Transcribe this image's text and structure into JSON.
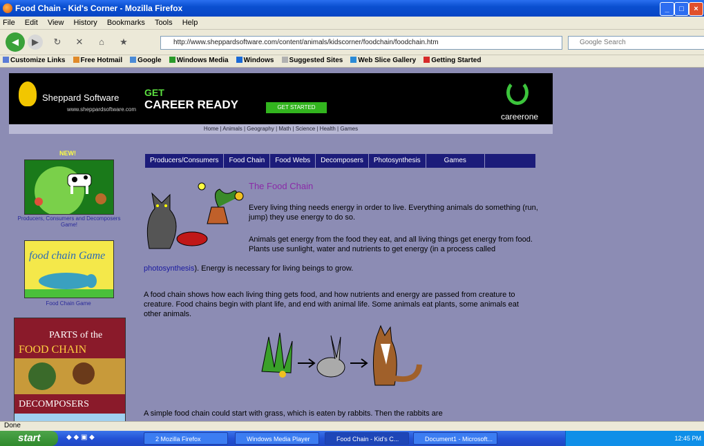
{
  "window": {
    "title": "Food Chain - Kid's Corner - Mozilla Firefox"
  },
  "menu": [
    "File",
    "Edit",
    "View",
    "History",
    "Bookmarks",
    "Tools",
    "Help"
  ],
  "nav": {
    "url": "http://www.sheppardsoftware.com/content/animals/kidscorner/foodchain/foodchain.htm",
    "search_placeholder": "Google Search"
  },
  "bookmarks": [
    "Customize Links",
    "Free Hotmail",
    "Google",
    "Windows Media",
    "Windows",
    "Suggested Sites",
    "Web Slice Gallery",
    "Getting Started"
  ],
  "banner": {
    "brand": "Sheppard Software",
    "brand_sub": "www.sheppardsoftware.com",
    "get": "GET",
    "career": "CAREER READY",
    "cta": "GET STARTED",
    "partner": "careerone"
  },
  "site_links": "Home | Animals | Geography | Math | Science | Health | Games",
  "tabs": [
    "Producers/Consumers",
    "Food Chain",
    "Food Webs",
    "Decomposers",
    "Photosynthesis",
    "Games"
  ],
  "sidebar": {
    "new": "NEW!",
    "cap1": "Producers, Consumers and Decomposers Game!",
    "img2": "food chain Game",
    "cap2": "Food Chain Game",
    "img3_top": "PARTS of the",
    "img3_mid": "FOOD CHAIN",
    "img3_bot": "DECOMPOSERS"
  },
  "article": {
    "heading": "The Food Chain",
    "p1": "Every living thing needs energy in order to live. Everything animals do something (run, jump) they use energy to do so.",
    "p2a": "Animals get energy from the food they eat, and all living things get energy from food. Plants use sunlight, water and nutrients to get energy (in a process called ",
    "p2link": "photosynthesis",
    "p2b": "). Energy is necessary for living beings to grow.",
    "p3": "A food chain shows how each living thing gets food, and how nutrients and energy are passed from creature to creature. Food chains begin with plant life, and end with animal life. Some animals eat plants, some animals eat other animals.",
    "p4": "A simple food chain could start with grass, which is eaten by rabbits. Then the rabbits are"
  },
  "status": {
    "text": "Done"
  },
  "taskbar": {
    "start": "start",
    "tasks": [
      "2 Mozilla Firefox",
      "Windows Media Player",
      "Food Chain - Kid's C...",
      "Document1 - Microsoft..."
    ],
    "clock": "12:45 PM"
  }
}
